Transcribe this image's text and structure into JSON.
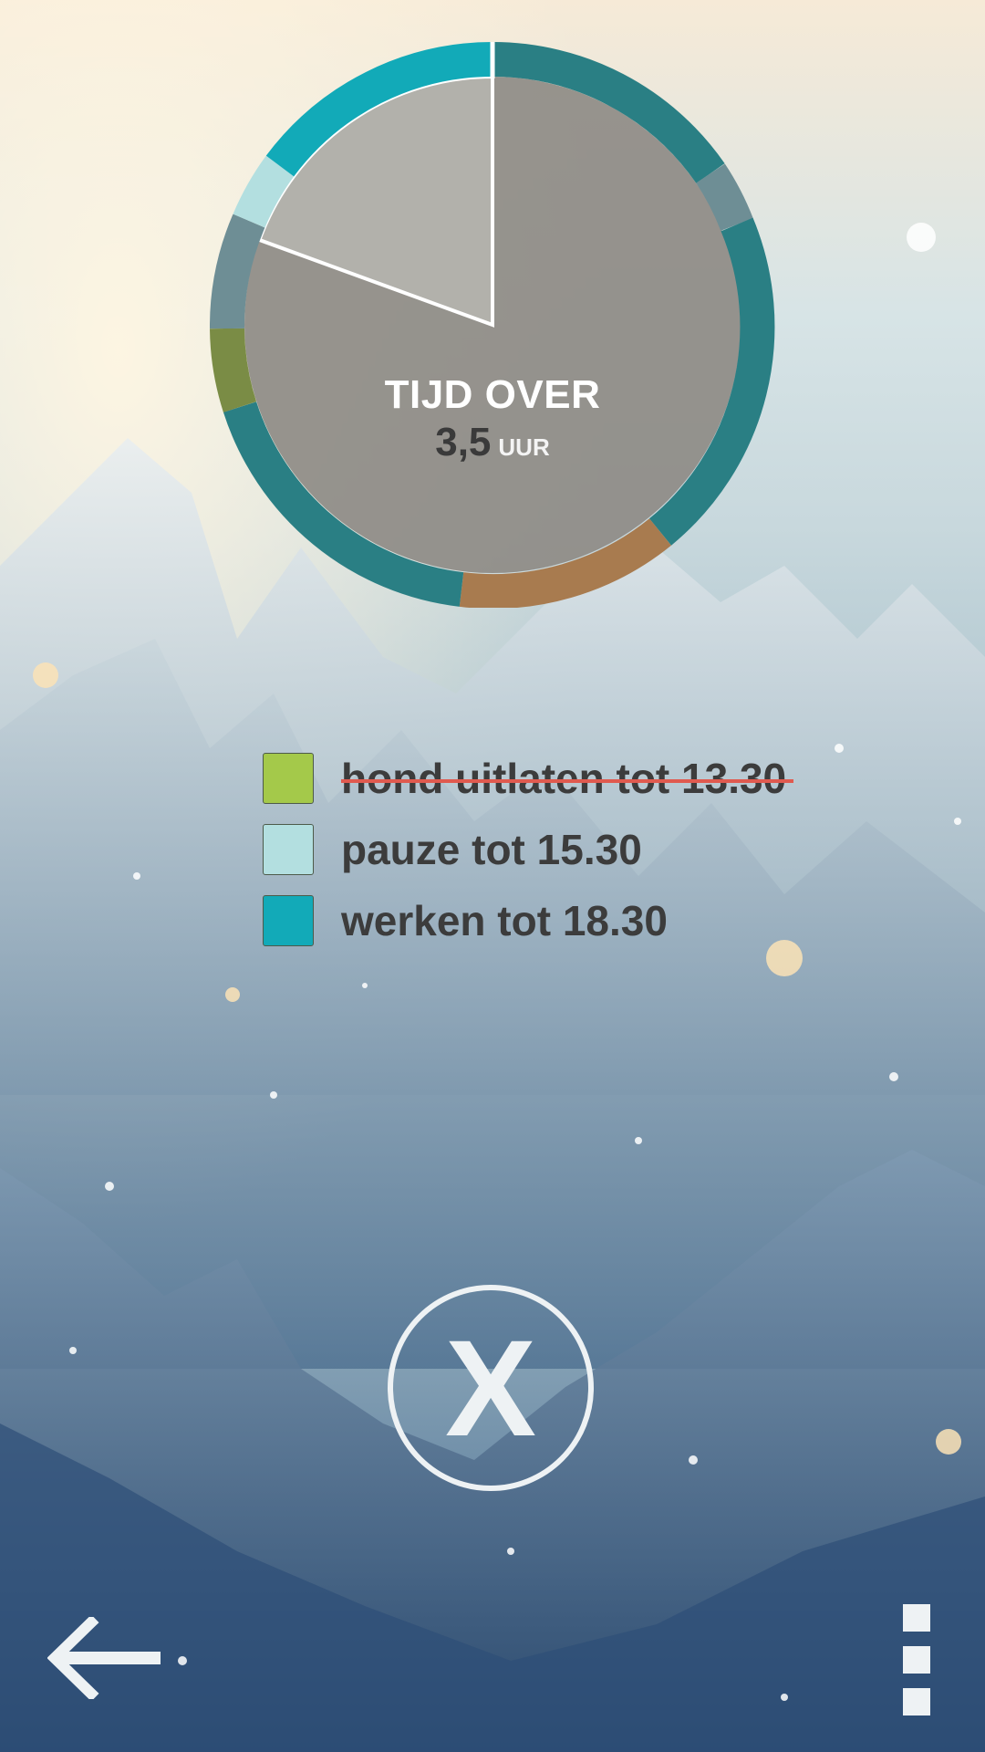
{
  "chart": {
    "title": "TIJD OVER",
    "value": "3,5",
    "unit": "UUR"
  },
  "tasks": [
    {
      "label": "hond uitlaten tot 13.30",
      "color": "#a4c94a",
      "done": true
    },
    {
      "label": "pauze tot 15.30",
      "color": "#b3dfe0",
      "done": false
    },
    {
      "label": "werken tot 18.30",
      "color": "#12aab8",
      "done": false
    }
  ],
  "colors": {
    "ring_dark_teal": "#2a7f84",
    "ring_bright_teal": "#12aab8",
    "ring_light_teal": "#b3dfe0",
    "ring_gray": "#6e8e95",
    "ring_green": "#7a8c45",
    "ring_brown": "#a87b4f",
    "fill_gray": "#8e8b85",
    "strike_red": "#e05a4f"
  },
  "controls": {
    "close_label": "X",
    "back_icon": "arrow-left-icon",
    "menu_icon": "more-vertical-icon"
  }
}
